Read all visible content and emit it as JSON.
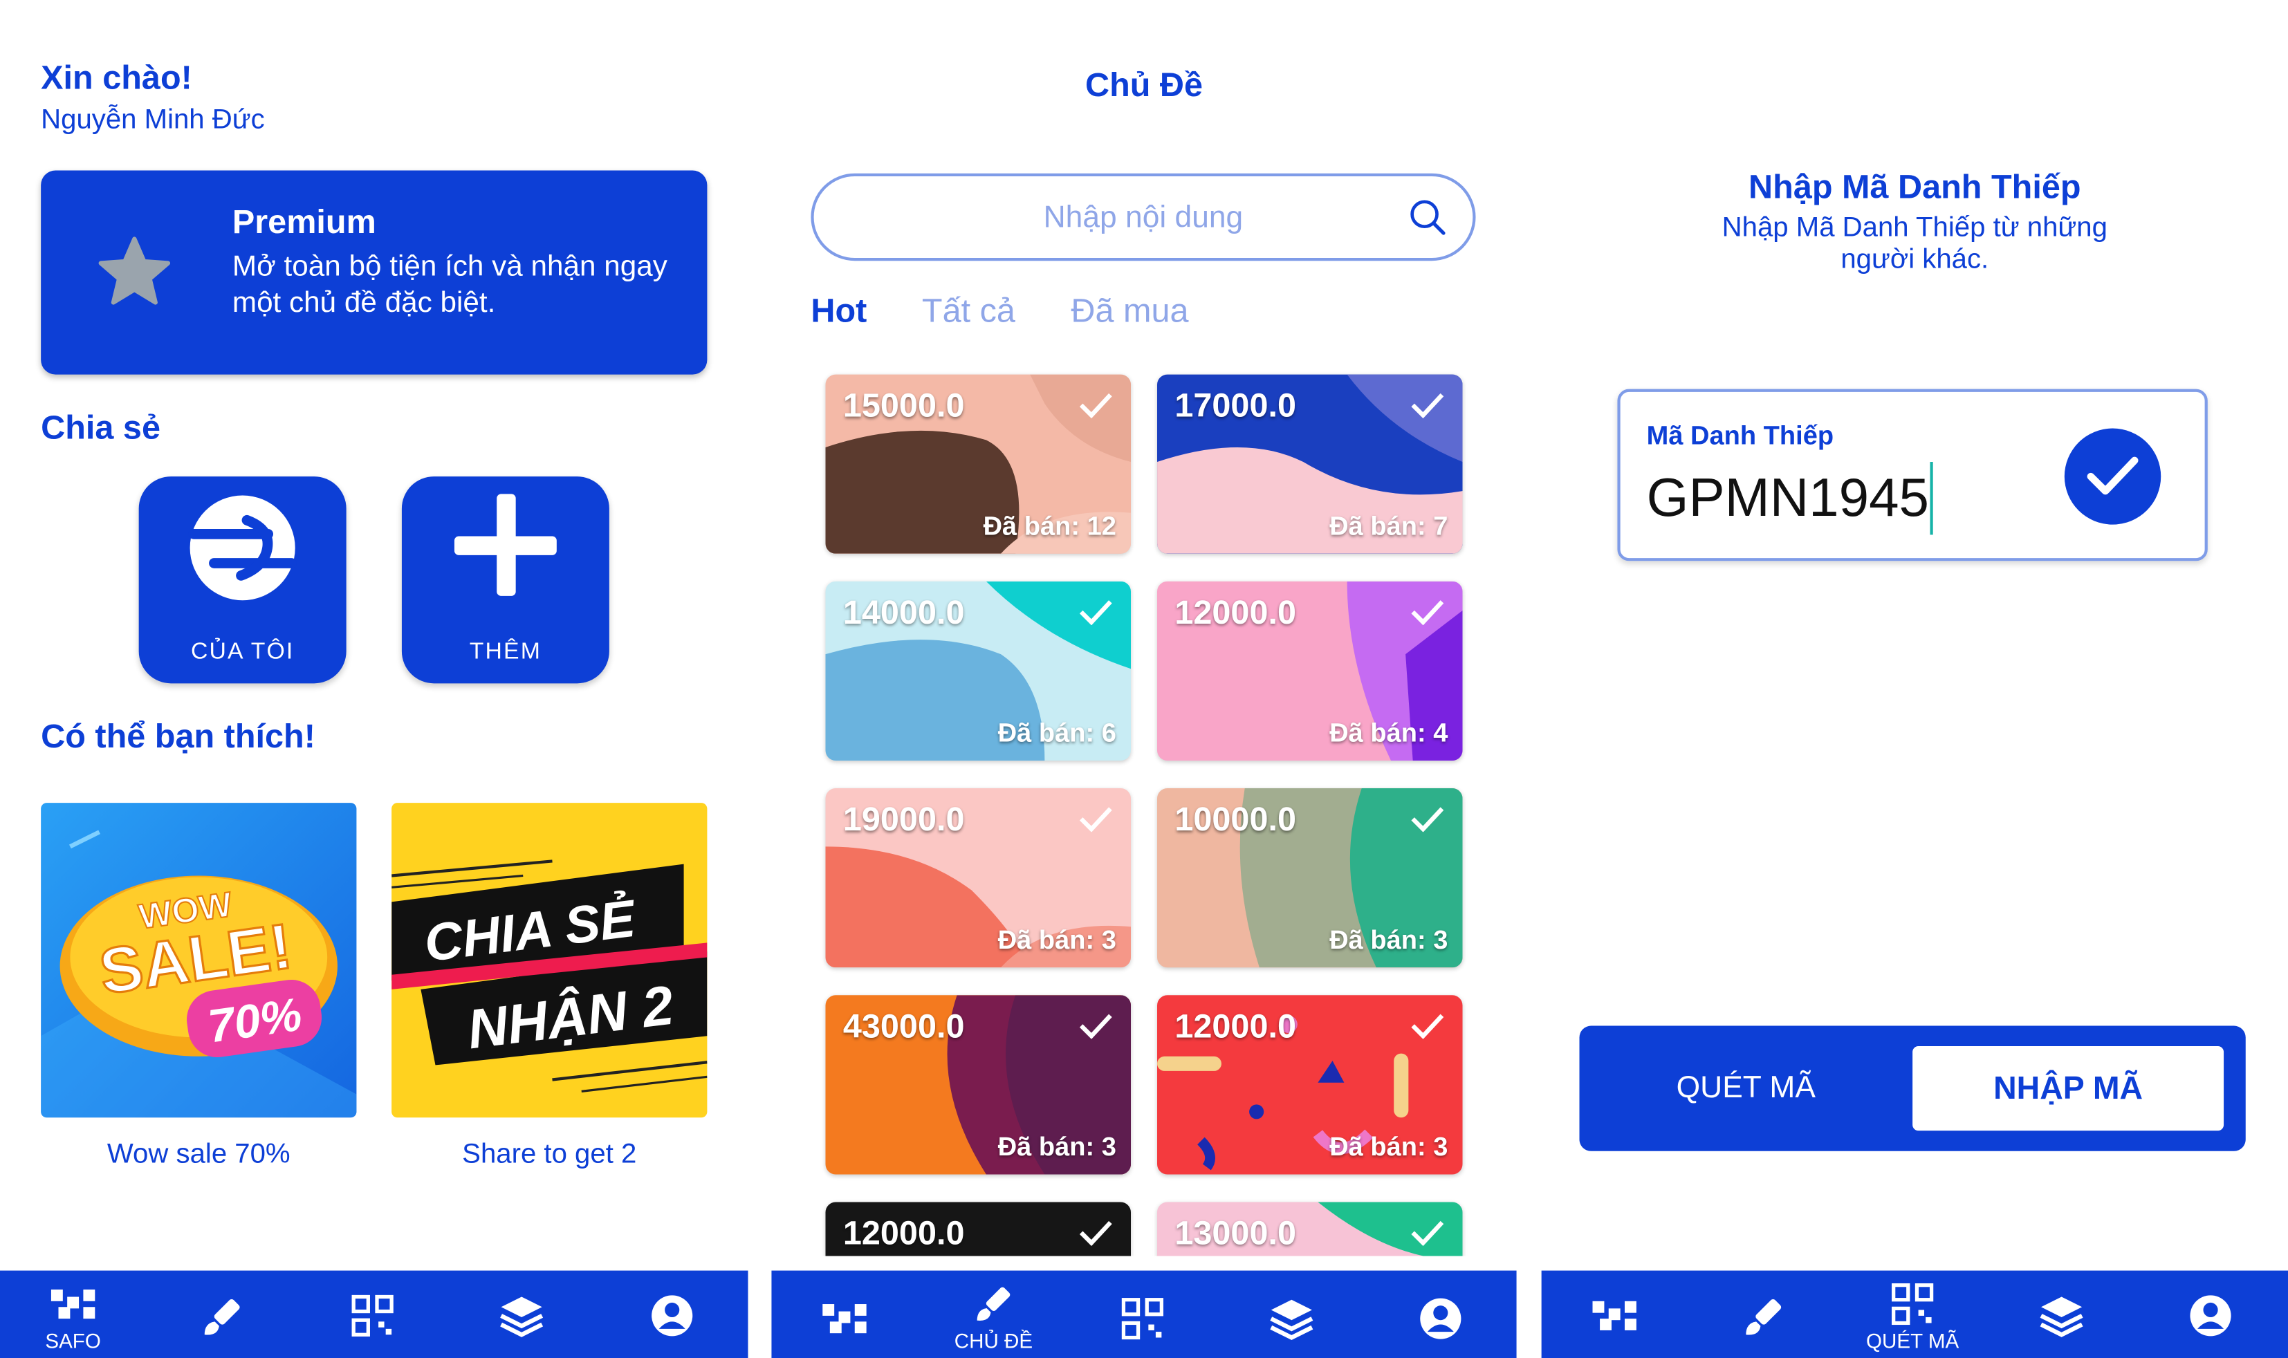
{
  "colors": {
    "primary": "#0d3fd6",
    "border": "#7f9ce8",
    "placeholder": "#8fa6e8"
  },
  "home": {
    "greeting": "Xin chào!",
    "user_name": "Nguyễn Minh Đức",
    "premium": {
      "title": "Premium",
      "description": "Mở toàn bộ tiện ích và nhận ngay một chủ đề đặc biệt.",
      "icon": "star-icon"
    },
    "share_title": "Chia sẻ",
    "share_buttons": [
      {
        "label": "CỦA TÔI",
        "icon": "logo-icon"
      },
      {
        "label": "THÊM",
        "icon": "plus-icon"
      }
    ],
    "suggest_title": "Có thể bạn thích!",
    "promos": [
      {
        "caption": "Wow sale 70%",
        "art_line1": "WOW",
        "art_line2": "SALE!",
        "art_line3": "70%"
      },
      {
        "caption": "Share to get 2",
        "art_line1": "CHIA SẺ",
        "art_line2": "NHẬN 2"
      }
    ]
  },
  "topics": {
    "title": "Chủ Đề",
    "search_placeholder": "Nhập nội dung",
    "tabs": [
      {
        "label": "Hot",
        "active": true
      },
      {
        "label": "Tất cả",
        "active": false
      },
      {
        "label": "Đã mua",
        "active": false
      }
    ],
    "cards": [
      {
        "price": "15000.0",
        "sold": "Đã bán: 12"
      },
      {
        "price": "17000.0",
        "sold": "Đã bán: 7"
      },
      {
        "price": "14000.0",
        "sold": "Đã bán: 6"
      },
      {
        "price": "12000.0",
        "sold": "Đã bán: 4"
      },
      {
        "price": "19000.0",
        "sold": "Đã bán: 3"
      },
      {
        "price": "10000.0",
        "sold": "Đã bán: 3"
      },
      {
        "price": "43000.0",
        "sold": "Đã bán: 3"
      },
      {
        "price": "12000.0",
        "sold": "Đã bán: 3"
      },
      {
        "price": "12000.0",
        "sold": ""
      },
      {
        "price": "13000.0",
        "sold": ""
      }
    ]
  },
  "code": {
    "title": "Nhập Mã Danh Thiếp",
    "description": "Nhập Mã Danh Thiếp từ những người khác.",
    "field_label": "Mã Danh Thiếp",
    "field_value": "GPMN1945",
    "segment": {
      "scan_label": "QUÉT MÃ",
      "enter_label": "NHẬP MÃ",
      "active": "enter"
    }
  },
  "nav": {
    "screen1": {
      "active": "safo",
      "label": "SAFO"
    },
    "screen2": {
      "active": "topics",
      "label": "CHỦ ĐỀ"
    },
    "screen3": {
      "active": "scan",
      "label": "QUÉT MÃ"
    },
    "icons": [
      "grid-icon",
      "brush-icon",
      "qr-icon",
      "layers-icon",
      "profile-icon"
    ]
  }
}
